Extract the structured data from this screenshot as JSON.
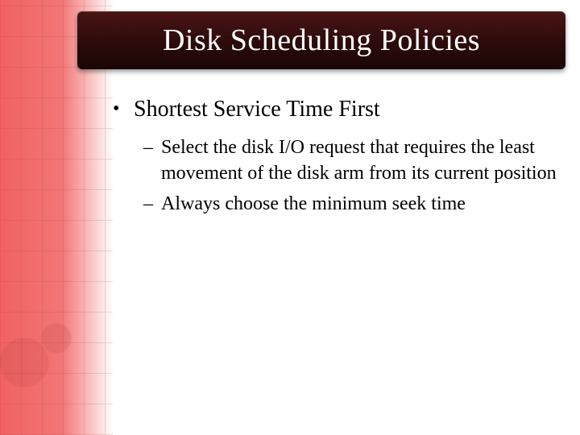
{
  "slide": {
    "title": "Disk Scheduling Policies",
    "bullets": [
      {
        "text": "Shortest Service Time First",
        "sub": [
          "Select the disk I/O request that requires the least movement of the disk arm from its current position",
          "Always choose the minimum seek time"
        ]
      }
    ]
  }
}
